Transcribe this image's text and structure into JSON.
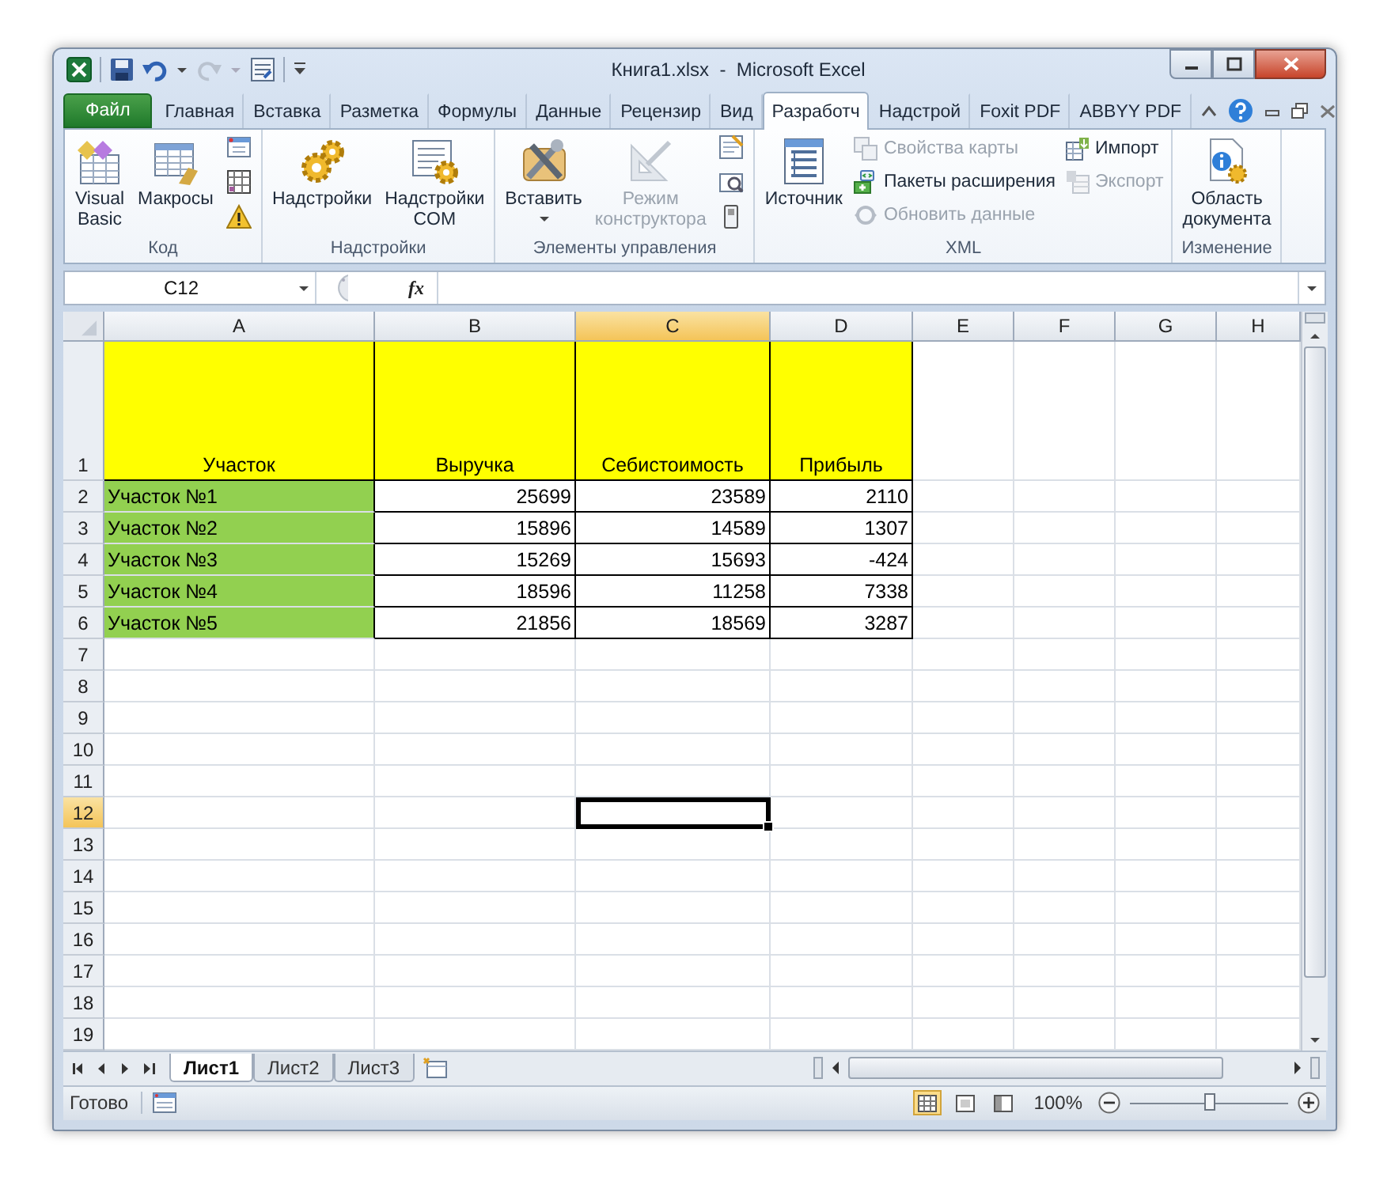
{
  "window": {
    "title": "Книга1.xlsx  -  Microsoft Excel"
  },
  "tabs": [
    {
      "label": "Файл",
      "kind": "file",
      "selected": false
    },
    {
      "label": "Главная",
      "kind": "tab",
      "selected": false
    },
    {
      "label": "Вставка",
      "kind": "tab",
      "selected": false
    },
    {
      "label": "Разметка",
      "kind": "tab",
      "selected": false
    },
    {
      "label": "Формулы",
      "kind": "tab",
      "selected": false
    },
    {
      "label": "Данные",
      "kind": "tab",
      "selected": false
    },
    {
      "label": "Рецензир",
      "kind": "tab",
      "selected": false
    },
    {
      "label": "Вид",
      "kind": "tab",
      "selected": false
    },
    {
      "label": "Разработч",
      "kind": "tab",
      "selected": true
    },
    {
      "label": "Надстрой",
      "kind": "tab",
      "selected": false
    },
    {
      "label": "Foxit PDF",
      "kind": "tab",
      "selected": false
    },
    {
      "label": "ABBYY PDF",
      "kind": "tab",
      "selected": false
    }
  ],
  "ribbon": {
    "groups": [
      {
        "label": "Код",
        "items": [
          {
            "kind": "large",
            "label": "Visual\nBasic",
            "disabled": false
          },
          {
            "kind": "large",
            "label": "Макросы",
            "disabled": false
          },
          {
            "kind": "icon_column"
          }
        ]
      },
      {
        "label": "Надстройки",
        "items": [
          {
            "kind": "large",
            "label": "Надстройки",
            "disabled": false
          },
          {
            "kind": "large",
            "label": "Надстройки\nCOM",
            "disabled": false
          }
        ]
      },
      {
        "label": "Элементы управления",
        "items": [
          {
            "kind": "large",
            "label": "Вставить",
            "disabled": false,
            "dropdown": true
          },
          {
            "kind": "large",
            "label": "Режим\nконструктора",
            "disabled": true
          },
          {
            "kind": "icon_column"
          }
        ]
      },
      {
        "label": "XML",
        "items": [
          {
            "kind": "large",
            "label": "Источник",
            "disabled": false
          },
          {
            "kind": "small_column",
            "entries": [
              {
                "label": "Свойства карты",
                "disabled": true
              },
              {
                "label": "Пакеты расширения",
                "disabled": false
              },
              {
                "label": "Обновить данные",
                "disabled": true
              }
            ]
          },
          {
            "kind": "small_column",
            "entries": [
              {
                "label": "Импорт",
                "disabled": false
              },
              {
                "label": "Экспорт",
                "disabled": true
              }
            ]
          }
        ]
      },
      {
        "label": "Изменение",
        "items": [
          {
            "kind": "large",
            "label": "Область\nдокумента",
            "disabled": false
          }
        ]
      }
    ]
  },
  "formula_bar": {
    "name_box": "C12",
    "function_label": "fx"
  },
  "columns": [
    {
      "label": "A",
      "selected": false
    },
    {
      "label": "B",
      "selected": false
    },
    {
      "label": "C",
      "selected": true
    },
    {
      "label": "D",
      "selected": false
    },
    {
      "label": "E",
      "selected": false
    },
    {
      "label": "F",
      "selected": false
    },
    {
      "label": "G",
      "selected": false
    },
    {
      "label": "H",
      "selected": false
    }
  ],
  "rows": [
    {
      "number": "1",
      "selected": false,
      "cells": [
        {
          "text": "Участок",
          "kind": "heading"
        },
        {
          "text": "Выручка",
          "kind": "heading"
        },
        {
          "text": "Себистоимость",
          "kind": "heading"
        },
        {
          "text": "Прибыль",
          "kind": "heading"
        }
      ]
    },
    {
      "number": "2",
      "selected": false,
      "cells": [
        {
          "text": "Участок №1",
          "kind": "label"
        },
        {
          "text": "25699",
          "kind": "number"
        },
        {
          "text": "23589",
          "kind": "number"
        },
        {
          "text": "2110",
          "kind": "number"
        }
      ]
    },
    {
      "number": "3",
      "selected": false,
      "cells": [
        {
          "text": "Участок №2",
          "kind": "label"
        },
        {
          "text": "15896",
          "kind": "number"
        },
        {
          "text": "14589",
          "kind": "number"
        },
        {
          "text": "1307",
          "kind": "number"
        }
      ]
    },
    {
      "number": "4",
      "selected": false,
      "cells": [
        {
          "text": "Участок №3",
          "kind": "label"
        },
        {
          "text": "15269",
          "kind": "number"
        },
        {
          "text": "15693",
          "kind": "number"
        },
        {
          "text": "-424",
          "kind": "number"
        }
      ]
    },
    {
      "number": "5",
      "selected": false,
      "cells": [
        {
          "text": "Участок №4",
          "kind": "label"
        },
        {
          "text": "18596",
          "kind": "number"
        },
        {
          "text": "11258",
          "kind": "number"
        },
        {
          "text": "7338",
          "kind": "number"
        }
      ]
    },
    {
      "number": "6",
      "selected": false,
      "cells": [
        {
          "text": "Участок №5",
          "kind": "label"
        },
        {
          "text": "21856",
          "kind": "number"
        },
        {
          "text": "18569",
          "kind": "number"
        },
        {
          "text": "3287",
          "kind": "number"
        }
      ]
    },
    {
      "number": "7",
      "selected": false
    },
    {
      "number": "8",
      "selected": false
    },
    {
      "number": "9",
      "selected": false
    },
    {
      "number": "10",
      "selected": false
    },
    {
      "number": "11",
      "selected": false
    },
    {
      "number": "12",
      "selected": true
    },
    {
      "number": "13",
      "selected": false
    },
    {
      "number": "14",
      "selected": false
    },
    {
      "number": "15",
      "selected": false
    },
    {
      "number": "16",
      "selected": false
    },
    {
      "number": "17",
      "selected": false
    },
    {
      "number": "18",
      "selected": false
    },
    {
      "number": "19",
      "selected": false
    }
  ],
  "sheet_tabs": [
    {
      "label": "Лист1",
      "selected": true
    },
    {
      "label": "Лист2",
      "selected": false
    },
    {
      "label": "Лист3",
      "selected": false
    }
  ],
  "status_bar": {
    "state": "Готово",
    "zoom": "100%",
    "zoom_slider": {
      "level": 0.5
    }
  }
}
